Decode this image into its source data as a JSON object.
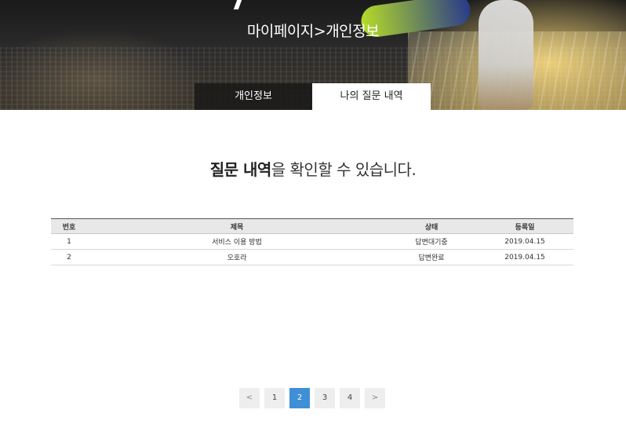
{
  "hero": {
    "title": "마이페이지>개인정보"
  },
  "tabs": [
    {
      "label": "개인정보",
      "active": false
    },
    {
      "label": "나의 질문 내역",
      "active": true
    }
  ],
  "heading": {
    "strong": "질문 내역",
    "rest": "을 확인할 수 있습니다."
  },
  "table": {
    "headers": [
      "번호",
      "제목",
      "상태",
      "등록일"
    ],
    "rows": [
      [
        "1",
        "서비스 이용 방법",
        "답변대기중",
        "2019.04.15"
      ],
      [
        "2",
        "오호라",
        "답변완료",
        "2019.04.15"
      ]
    ]
  },
  "pagination": {
    "prev": "<",
    "pages": [
      "1",
      "2",
      "3",
      "4"
    ],
    "current": "2",
    "next": ">"
  },
  "colors": {
    "accent": "#3f8fd6",
    "tab_inactive_bg": "#191919",
    "header_bg": "#e8e8e8"
  }
}
